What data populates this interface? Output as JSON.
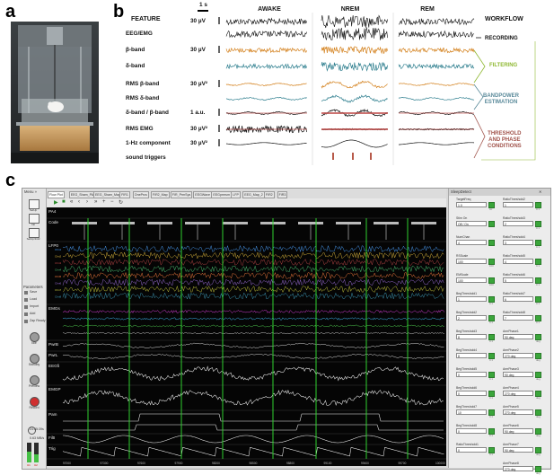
{
  "panels": {
    "a": "a",
    "b": "b",
    "c": "c"
  },
  "photo": {
    "icon": "rodent-recording-cage-photo"
  },
  "panel_b": {
    "feature_header": "FEATURE",
    "scale_time": "1 s",
    "columns": [
      "AWAKE",
      "NREM",
      "REM"
    ],
    "workflow_header": "WORKFLOW",
    "rows": [
      {
        "label": "",
        "scale": "30 µV",
        "color": "#111111"
      },
      {
        "label": "EEG/EMG",
        "scale": "",
        "color": "#111111"
      },
      {
        "label": "β-band",
        "scale": "30 µV",
        "color": "#d4821f"
      },
      {
        "label": "δ-band",
        "scale": "",
        "color": "#2f7f8f"
      },
      {
        "label": "RMS β-band",
        "scale": "30 µV²",
        "color": "#d4821f"
      },
      {
        "label": "RMS δ-band",
        "scale": "",
        "color": "#2f7f8f"
      },
      {
        "label": "δ-band / β-band",
        "scale": "1 a.u.",
        "color": "#111111"
      },
      {
        "label": "RMS EMG",
        "scale": "30 µV²",
        "color": "#111111"
      },
      {
        "label": "1-Hz component",
        "scale": "30 µV²",
        "color": "#111111"
      },
      {
        "label": "sound triggers",
        "scale": "",
        "color": "#b85a4a"
      }
    ],
    "workflow": [
      {
        "label": "RECORDING",
        "color": "#111111"
      },
      {
        "label": "FILTERING",
        "color": "#8fb832"
      },
      {
        "label": "BANDPOWER\nESTIMATION",
        "color": "#5a8a9a"
      },
      {
        "label": "THRESHOLD\nAND PHASE\nCONDITIONS",
        "color": "#a0524a"
      }
    ],
    "colors": {
      "beta": "#d4821f",
      "delta": "#2f7f8f",
      "threshold": "#c0504d",
      "filtering": "#8fb832",
      "bandpower": "#5a8a9a",
      "condition": "#a0524a"
    }
  },
  "software": {
    "left_bar": {
      "menu": "Menu »",
      "buttons": [
        "SetUp",
        "Init",
        "SetUp/Init2"
      ],
      "params_header": "Parameters",
      "params": [
        "Save",
        "Load",
        "Import",
        "Add",
        "Zap Ready"
      ],
      "run_buttons": [
        "Idle",
        "Standby",
        "Preview",
        "Record"
      ],
      "disk_time": "24:35:39s",
      "disk_rate": "0.63 MB/s",
      "meter_labels": [
        "U1",
        "U2"
      ]
    },
    "tabs": [
      "Flow Plot",
      "EEG_Sham_PA",
      "EEG_Sham_Map",
      "FIR1",
      "OnePrcs",
      "FIR2_Map",
      "FIR_PrmSys",
      "EEGWave",
      "EEGprmsm",
      "LFP",
      "EEG_Map_2",
      "FIR2",
      "FIR3"
    ],
    "toolbar_icons": [
      "play-icon",
      "stop-icon",
      "rewind-icon",
      "step-back-icon",
      "step-forward-icon",
      "fast-forward-icon",
      "zoom-in-icon",
      "zoom-out-icon",
      "refresh-icon"
    ],
    "channels": [
      "PA4",
      "Code",
      "LFP0",
      "EMGs",
      "PwrB",
      "PwrL",
      "EEGfi",
      "EMGP",
      "Pam",
      "FiltI",
      "Trig"
    ],
    "lfp_sub_labels": [
      "Chn1",
      "Chn2",
      "Chn3",
      "Chn4",
      "Chn5",
      "Chn6",
      "Chn7",
      "Chn8"
    ],
    "xaxis_ticks": [
      "97000",
      "97300",
      "97600",
      "97900",
      "98200",
      "98500",
      "98800",
      "99100",
      "99400",
      "99700",
      "100000"
    ],
    "right_panel_title": "SleepDetect",
    "right_col1": [
      {
        "label": "TargetFreq",
        "value": "1.0",
        "unit": "Hz"
      },
      {
        "label": "Stim On",
        "value": "Off / On",
        "unit": ""
      },
      {
        "label": "NumChan",
        "value": "4",
        "unit": ""
      },
      {
        "label": "RSScale",
        "value": "100",
        "unit": "100"
      },
      {
        "label": "EMScale",
        "value": "100",
        "unit": "100"
      },
      {
        "label": "BegThreshold1",
        "value": "1",
        "unit": "0.1"
      },
      {
        "label": "BegThreshold2",
        "value": "2",
        "unit": "0.1"
      },
      {
        "label": "BegThreshold3",
        "value": "8",
        "unit": "0.1"
      },
      {
        "label": "BegThreshold4",
        "value": "8",
        "unit": "0.1"
      },
      {
        "label": "BegThreshold5",
        "value": "0",
        "unit": "0.1"
      },
      {
        "label": "BegThreshold6",
        "value": "0",
        "unit": "0.1"
      },
      {
        "label": "BegThreshold7",
        "value": "10",
        "unit": "0.1"
      },
      {
        "label": "BegThreshold8",
        "value": "0",
        "unit": "0.1"
      },
      {
        "label": "RatioThreshold1",
        "value": "0",
        "unit": "0.1"
      }
    ],
    "right_col2": [
      {
        "label": "RatioThreshold2",
        "value": "1",
        "unit": "0.1"
      },
      {
        "label": "RatioThreshold3",
        "value": "2",
        "unit": "0.1"
      },
      {
        "label": "RatioThreshold4",
        "value": "3",
        "unit": "0.1"
      },
      {
        "label": "RatioThreshold5",
        "value": "4",
        "unit": "0.1"
      },
      {
        "label": "RatioThreshold6",
        "value": "5",
        "unit": "0.1"
      },
      {
        "label": "RatioThreshold7",
        "value": "6",
        "unit": "0.1"
      },
      {
        "label": "RatioThreshold8",
        "value": "7",
        "unit": "0.1"
      },
      {
        "label": "ArmPhase1",
        "value": "90 deg",
        "unit": "deg"
      },
      {
        "label": "ArmPhase2",
        "value": "270 deg",
        "unit": "deg"
      },
      {
        "label": "ArmPhase3",
        "value": "90 deg",
        "unit": "deg"
      },
      {
        "label": "ArmPhase4",
        "value": "270 deg",
        "unit": "deg"
      },
      {
        "label": "ArmPhase5",
        "value": "270 deg",
        "unit": "deg"
      },
      {
        "label": "ArmPhase6",
        "value": "90 deg",
        "unit": "deg"
      },
      {
        "label": "ArmPhase7",
        "value": "90 deg",
        "unit": "deg"
      },
      {
        "label": "ArmPhase8",
        "value": "270 deg",
        "unit": "deg"
      }
    ]
  }
}
